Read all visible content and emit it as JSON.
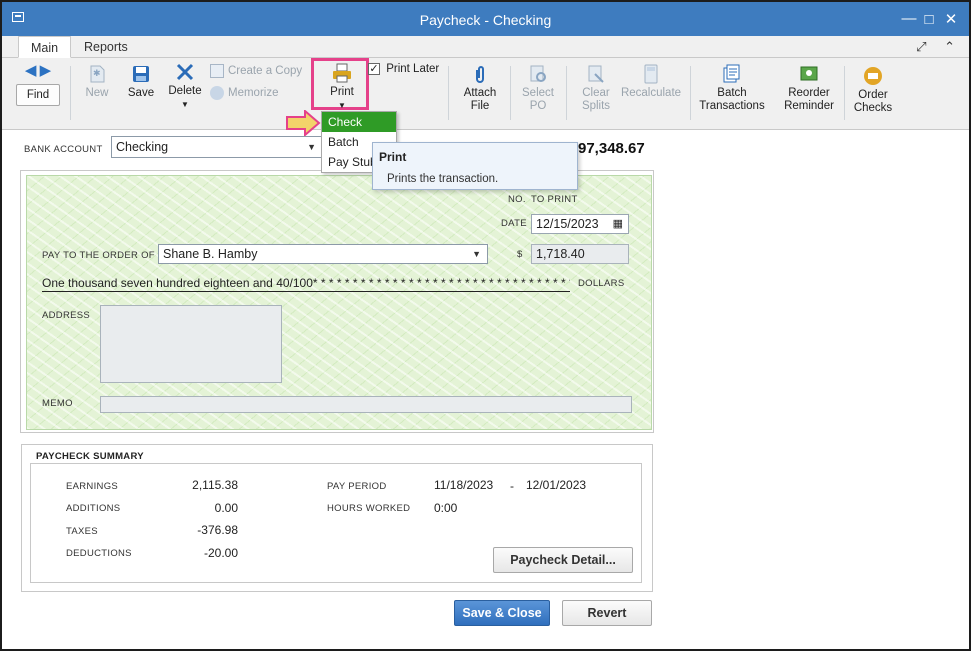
{
  "window": {
    "title": "Paycheck - Checking"
  },
  "tabs": [
    {
      "label": "Main"
    },
    {
      "label": "Reports"
    }
  ],
  "toolbar": {
    "find": "Find",
    "new": "New",
    "save": "Save",
    "delete": "Delete",
    "create_copy": "Create a Copy",
    "memorize": "Memorize",
    "print": "Print",
    "print_later": "Print Later",
    "attach_file": [
      "Attach",
      "File"
    ],
    "select_po": [
      "Select",
      "PO"
    ],
    "clear_splits": [
      "Clear",
      "Splits"
    ],
    "recalculate": "Recalculate",
    "batch_transactions": [
      "Batch",
      "Transactions"
    ],
    "reorder_reminder": [
      "Reorder",
      "Reminder"
    ],
    "order_checks": [
      "Order",
      "Checks"
    ]
  },
  "print_menu": {
    "items": [
      "Check",
      "Batch",
      "Pay Stub"
    ],
    "selected": "Check"
  },
  "tooltip": {
    "title": "Print",
    "body": "Prints the transaction."
  },
  "bank": {
    "label": "BANK ACCOUNT",
    "account": "Checking",
    "balance": "97,348.67"
  },
  "check": {
    "no_label": "NO.",
    "no_value": "TO PRINT",
    "date_label": "DATE",
    "date": "12/15/2023",
    "payto_label": "PAY TO THE ORDER OF",
    "payee": "Shane B. Hamby",
    "dollar_sign": "$",
    "amount": "1,718.40",
    "amount_words": "One thousand seven hundred eighteen and 40/100* * * * * * * * * * * * * * * * * * * * * * * * * * * * * * * * * *",
    "dollars_label": "DOLLARS",
    "address_label": "ADDRESS",
    "memo_label": "MEMO"
  },
  "summary": {
    "title": "PAYCHECK SUMMARY",
    "rows": [
      {
        "label": "EARNINGS",
        "value": "2,115.38"
      },
      {
        "label": "ADDITIONS",
        "value": "0.00"
      },
      {
        "label": "TAXES",
        "value": "-376.98"
      },
      {
        "label": "DEDUCTIONS",
        "value": "-20.00"
      }
    ],
    "pay_period_label": "PAY PERIOD",
    "pay_period_start": "11/18/2023",
    "pay_period_sep": "-",
    "pay_period_end": "12/01/2023",
    "hours_label": "HOURS WORKED",
    "hours": "0:00",
    "detail_button": "Paycheck Detail..."
  },
  "buttons": {
    "save_close": "Save & Close",
    "revert": "Revert"
  },
  "colors": {
    "titlebar": "#3e7cbf",
    "menu_selected": "#2f9b26",
    "highlight": "#e5418a",
    "check_bg": "#e4f3d6"
  }
}
